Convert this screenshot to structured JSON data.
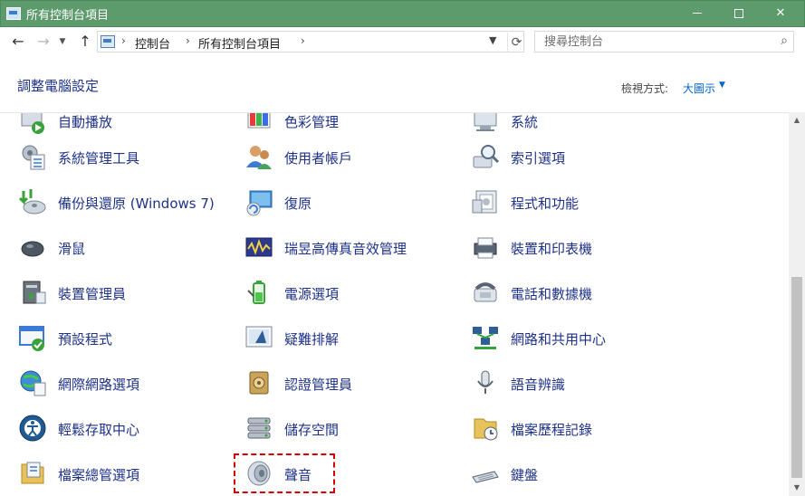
{
  "window": {
    "title": "所有控制台項目",
    "buttons": {
      "minimize": "minimize",
      "maximize": "maximize",
      "close": "✕"
    }
  },
  "address": {
    "crumbs": [
      "控制台",
      "所有控制台項目"
    ],
    "search_placeholder": "搜尋控制台"
  },
  "header": {
    "page_title": "調整電腦設定",
    "view_label": "檢視方式:",
    "view_value": "大圖示"
  },
  "items": [
    {
      "label": "自動播放",
      "icon": "autoplay-icon",
      "col": 0,
      "row": 0,
      "partial": true
    },
    {
      "label": "色彩管理",
      "icon": "color-management-icon",
      "col": 1,
      "row": 0,
      "partial": true
    },
    {
      "label": "系統",
      "icon": "system-icon",
      "col": 2,
      "row": 0,
      "partial": true
    },
    {
      "label": "系統管理工具",
      "icon": "admin-tools-icon",
      "col": 0,
      "row": 1
    },
    {
      "label": "使用者帳戶",
      "icon": "user-accounts-icon",
      "col": 1,
      "row": 1
    },
    {
      "label": "索引選項",
      "icon": "indexing-options-icon",
      "col": 2,
      "row": 1
    },
    {
      "label": "備份與還原 (Windows 7)",
      "icon": "backup-restore-icon",
      "col": 0,
      "row": 2
    },
    {
      "label": "復原",
      "icon": "recovery-icon",
      "col": 1,
      "row": 2
    },
    {
      "label": "程式和功能",
      "icon": "programs-features-icon",
      "col": 2,
      "row": 2
    },
    {
      "label": "滑鼠",
      "icon": "mouse-icon",
      "col": 0,
      "row": 3
    },
    {
      "label": "瑞昱高傳真音效管理",
      "icon": "realtek-audio-icon",
      "col": 1,
      "row": 3
    },
    {
      "label": "裝置和印表機",
      "icon": "devices-printers-icon",
      "col": 2,
      "row": 3
    },
    {
      "label": "裝置管理員",
      "icon": "device-manager-icon",
      "col": 0,
      "row": 4
    },
    {
      "label": "電源選項",
      "icon": "power-options-icon",
      "col": 1,
      "row": 4
    },
    {
      "label": "電話和數據機",
      "icon": "phone-modem-icon",
      "col": 2,
      "row": 4
    },
    {
      "label": "預設程式",
      "icon": "default-programs-icon",
      "col": 0,
      "row": 5
    },
    {
      "label": "疑難排解",
      "icon": "troubleshooting-icon",
      "col": 1,
      "row": 5
    },
    {
      "label": "網路和共用中心",
      "icon": "network-sharing-icon",
      "col": 2,
      "row": 5
    },
    {
      "label": "網際網路選項",
      "icon": "internet-options-icon",
      "col": 0,
      "row": 6
    },
    {
      "label": "認證管理員",
      "icon": "credential-manager-icon",
      "col": 1,
      "row": 6
    },
    {
      "label": "語音辨識",
      "icon": "speech-recognition-icon",
      "col": 2,
      "row": 6
    },
    {
      "label": "輕鬆存取中心",
      "icon": "ease-of-access-icon",
      "col": 0,
      "row": 7
    },
    {
      "label": "儲存空間",
      "icon": "storage-spaces-icon",
      "col": 1,
      "row": 7
    },
    {
      "label": "檔案歷程記錄",
      "icon": "file-history-icon",
      "col": 2,
      "row": 7
    },
    {
      "label": "檔案總管選項",
      "icon": "file-explorer-options-icon",
      "col": 0,
      "row": 8
    },
    {
      "label": "聲音",
      "icon": "sound-icon",
      "col": 1,
      "row": 8
    },
    {
      "label": "鍵盤",
      "icon": "keyboard-icon",
      "col": 2,
      "row": 8
    }
  ],
  "colors": {
    "titlebar": "#5d9b6c",
    "link": "#1e3287",
    "accent": "#0066cc",
    "highlight_box": "#d60000"
  }
}
